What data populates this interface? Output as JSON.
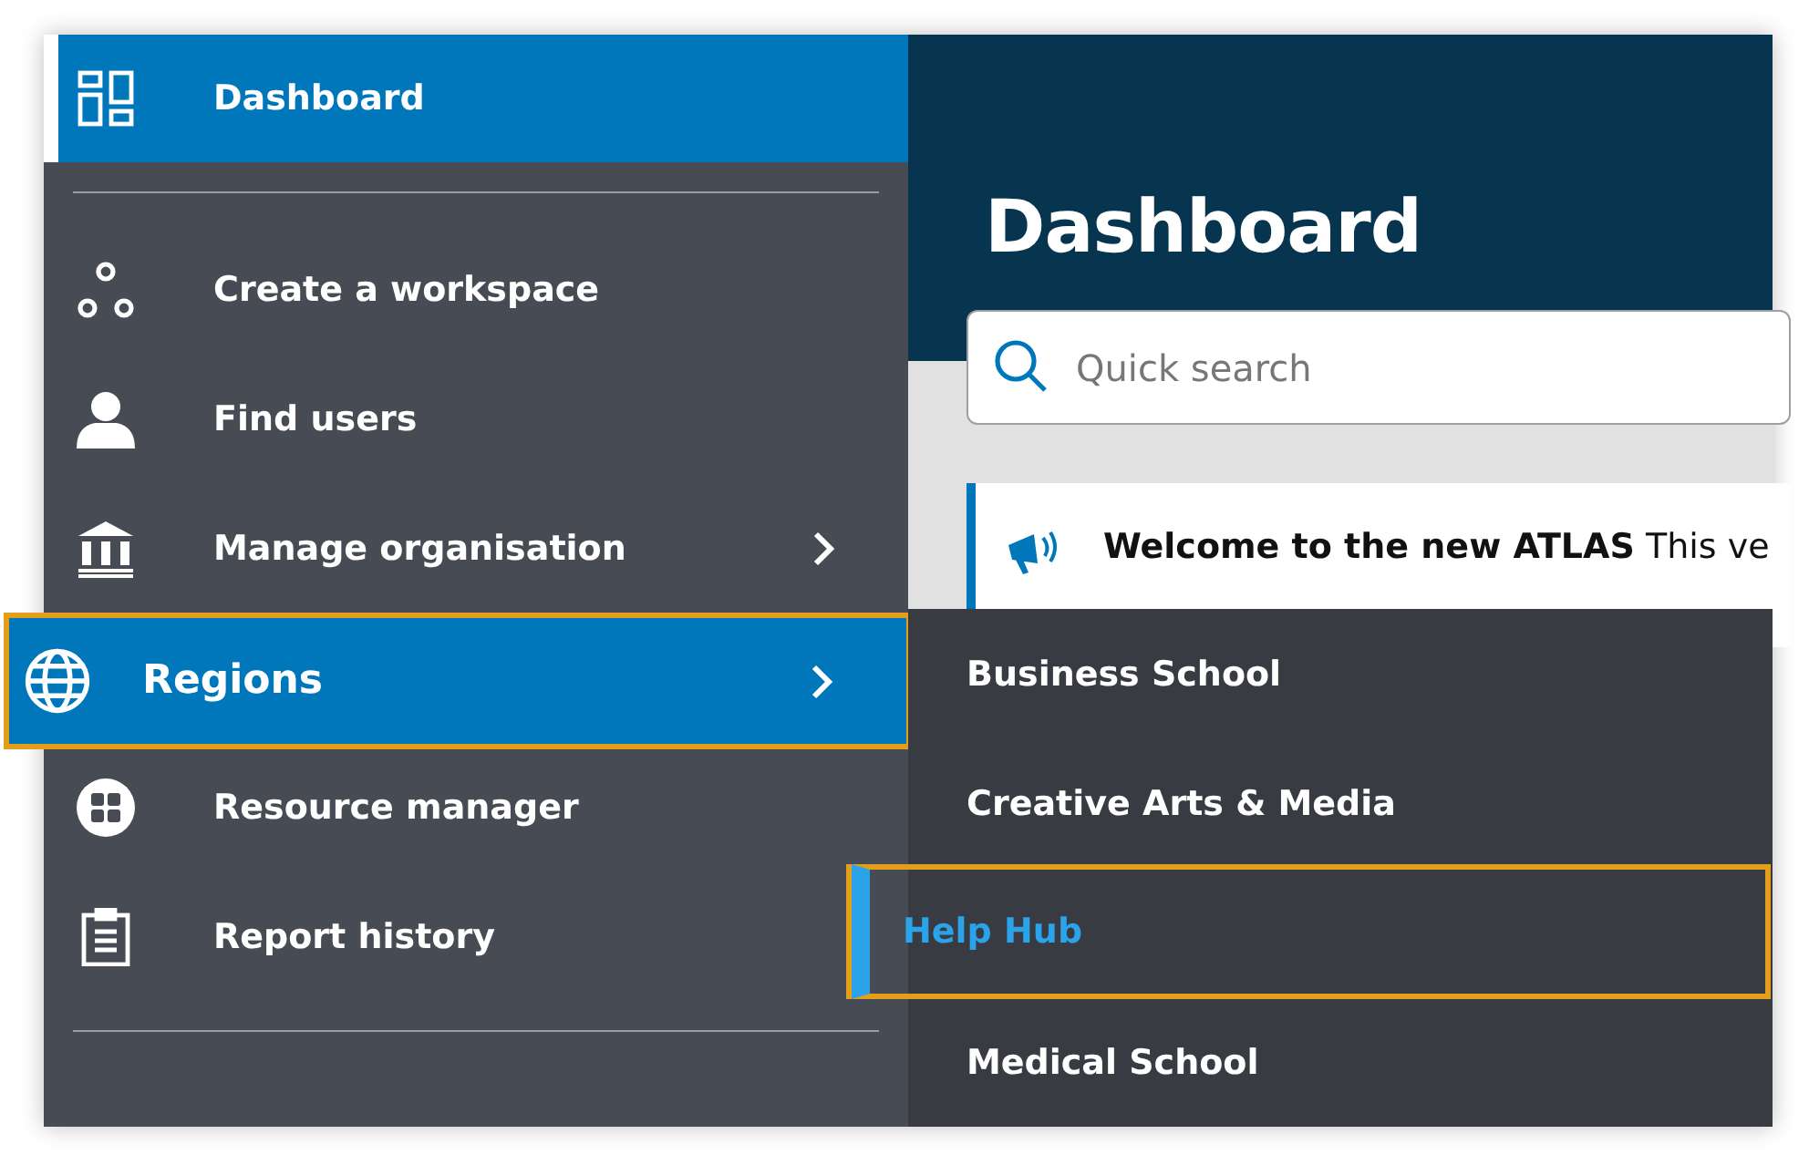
{
  "sidebar": {
    "items": [
      {
        "kind": "item",
        "label": "Dashboard",
        "selected": true,
        "highlighted": false,
        "has_submenu": false
      },
      {
        "kind": "divider"
      },
      {
        "kind": "item",
        "label": "Create a workspace",
        "selected": false,
        "highlighted": false,
        "has_submenu": false
      },
      {
        "kind": "item",
        "label": "Find users",
        "selected": false,
        "highlighted": false,
        "has_submenu": false
      },
      {
        "kind": "item",
        "label": "Manage organisation",
        "selected": false,
        "highlighted": false,
        "has_submenu": true
      },
      {
        "kind": "item",
        "label": "Regions",
        "selected": false,
        "highlighted": true,
        "has_submenu": true
      },
      {
        "kind": "item",
        "label": "Resource manager",
        "selected": false,
        "highlighted": false,
        "has_submenu": false
      },
      {
        "kind": "item",
        "label": "Report history",
        "selected": false,
        "highlighted": false,
        "has_submenu": false
      },
      {
        "kind": "divider"
      }
    ]
  },
  "main": {
    "title": "Dashboard",
    "search": {
      "placeholder": "Quick search"
    },
    "notice": "**Welcome to the new ATLAS** This ve"
  },
  "submenu": {
    "items": [
      {
        "label": "Business School",
        "selected": false,
        "highlighted": false
      },
      {
        "label": "Creative Arts & Media",
        "selected": false,
        "highlighted": false
      },
      {
        "label": "Help Hub",
        "selected": true,
        "highlighted": true
      },
      {
        "label": "Medical School",
        "selected": false,
        "highlighted": false
      }
    ]
  }
}
